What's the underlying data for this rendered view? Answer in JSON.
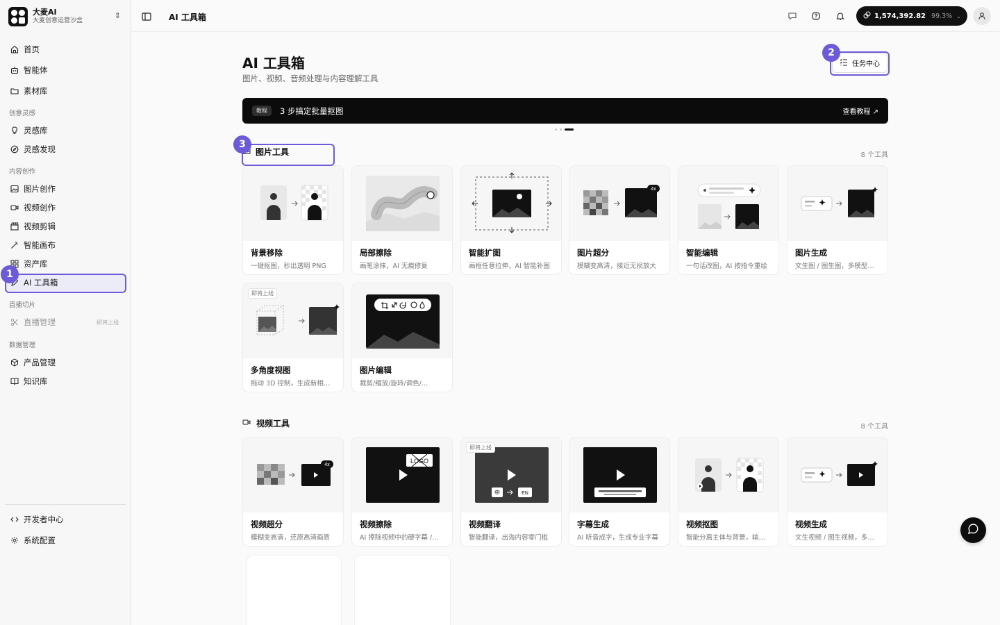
{
  "brand": {
    "name": "大麦AI",
    "subtitle": "大麦创意运营沙盒"
  },
  "sidebar": {
    "items": [
      {
        "label": "首页",
        "icon": "home-icon"
      },
      {
        "label": "智能体",
        "icon": "robot-icon"
      },
      {
        "label": "素材库",
        "icon": "folder-icon"
      },
      {
        "label": "灵感库",
        "icon": "lightbulb-icon"
      },
      {
        "label": "灵感发现",
        "icon": "compass-icon"
      },
      {
        "label": "图片创作",
        "icon": "image-icon"
      },
      {
        "label": "视频创作",
        "icon": "video-icon"
      },
      {
        "label": "视频剪辑",
        "icon": "clapper-icon"
      },
      {
        "label": "智能画布",
        "icon": "magic-wand-icon"
      },
      {
        "label": "资产库",
        "icon": "grid-icon"
      },
      {
        "label": "AI 工具箱",
        "icon": "pen-tool-icon"
      },
      {
        "label": "直播管理",
        "icon": "scissors-icon",
        "badge": "即将上线"
      },
      {
        "label": "产品管理",
        "icon": "box-icon"
      },
      {
        "label": "知识库",
        "icon": "book-icon"
      }
    ],
    "sections": [
      "创意灵感",
      "内容创作",
      "直播切片",
      "数据管理"
    ],
    "bottom": [
      {
        "label": "开发者中心",
        "icon": "code-icon"
      },
      {
        "label": "系统配置",
        "icon": "gear-icon"
      }
    ]
  },
  "topbar": {
    "breadcrumb": "AI 工具箱",
    "credits": "1,574,392.82",
    "credits_pct": "99.3%"
  },
  "main": {
    "title": "AI 工具箱",
    "subtitle": "图片、视频、音频处理与内容理解工具",
    "task_center": "任务中心",
    "banner": {
      "tag": "教程",
      "text": "3 步搞定批量抠图",
      "link": "查看教程 ↗"
    },
    "image_section": {
      "title": "图片工具",
      "count": "8 个工具",
      "cards": [
        {
          "name": "背景移除",
          "desc": "一键抠图，秒出透明 PNG"
        },
        {
          "name": "局部擦除",
          "desc": "画笔涂抹，AI 无痕修复"
        },
        {
          "name": "智能扩图",
          "desc": "画框任意拉伸，AI 智能补图"
        },
        {
          "name": "图片超分",
          "desc": "模糊变高清，接近无损放大"
        },
        {
          "name": "智能编辑",
          "desc": "一句话改图，AI 按指令重绘"
        },
        {
          "name": "图片生成",
          "desc": "文生图 / 图生图，多模型…"
        },
        {
          "name": "多角度视图",
          "desc": "拖动 3D 控制，生成新相…",
          "badge": "即将上线"
        },
        {
          "name": "图片编辑",
          "desc": "裁剪/缩放/旋转/调色/…"
        }
      ]
    },
    "video_section": {
      "title": "视频工具",
      "count": "8 个工具",
      "cards": [
        {
          "name": "视频超分",
          "desc": "模糊变高清，还原高清画质"
        },
        {
          "name": "视频擦除",
          "desc": "AI 擦除视频中的硬字幕 /…"
        },
        {
          "name": "视频翻译",
          "desc": "智能翻译，出海内容零门槛",
          "badge": "即将上线"
        },
        {
          "name": "字幕生成",
          "desc": "AI 听音成字，生成专业字幕"
        },
        {
          "name": "视频抠图",
          "desc": "智能分离主体与背景，输…"
        },
        {
          "name": "视频生成",
          "desc": "文生视频 / 图生视频，多…"
        }
      ]
    },
    "thumb_labels": {
      "upscale": "4x",
      "logo": "LOGO",
      "lang_from": "中",
      "lang_to": "EN"
    }
  },
  "annotations": [
    "1",
    "2",
    "3"
  ],
  "colors": {
    "accent": "#6b5bd9",
    "dark": "#0b0b0b"
  }
}
